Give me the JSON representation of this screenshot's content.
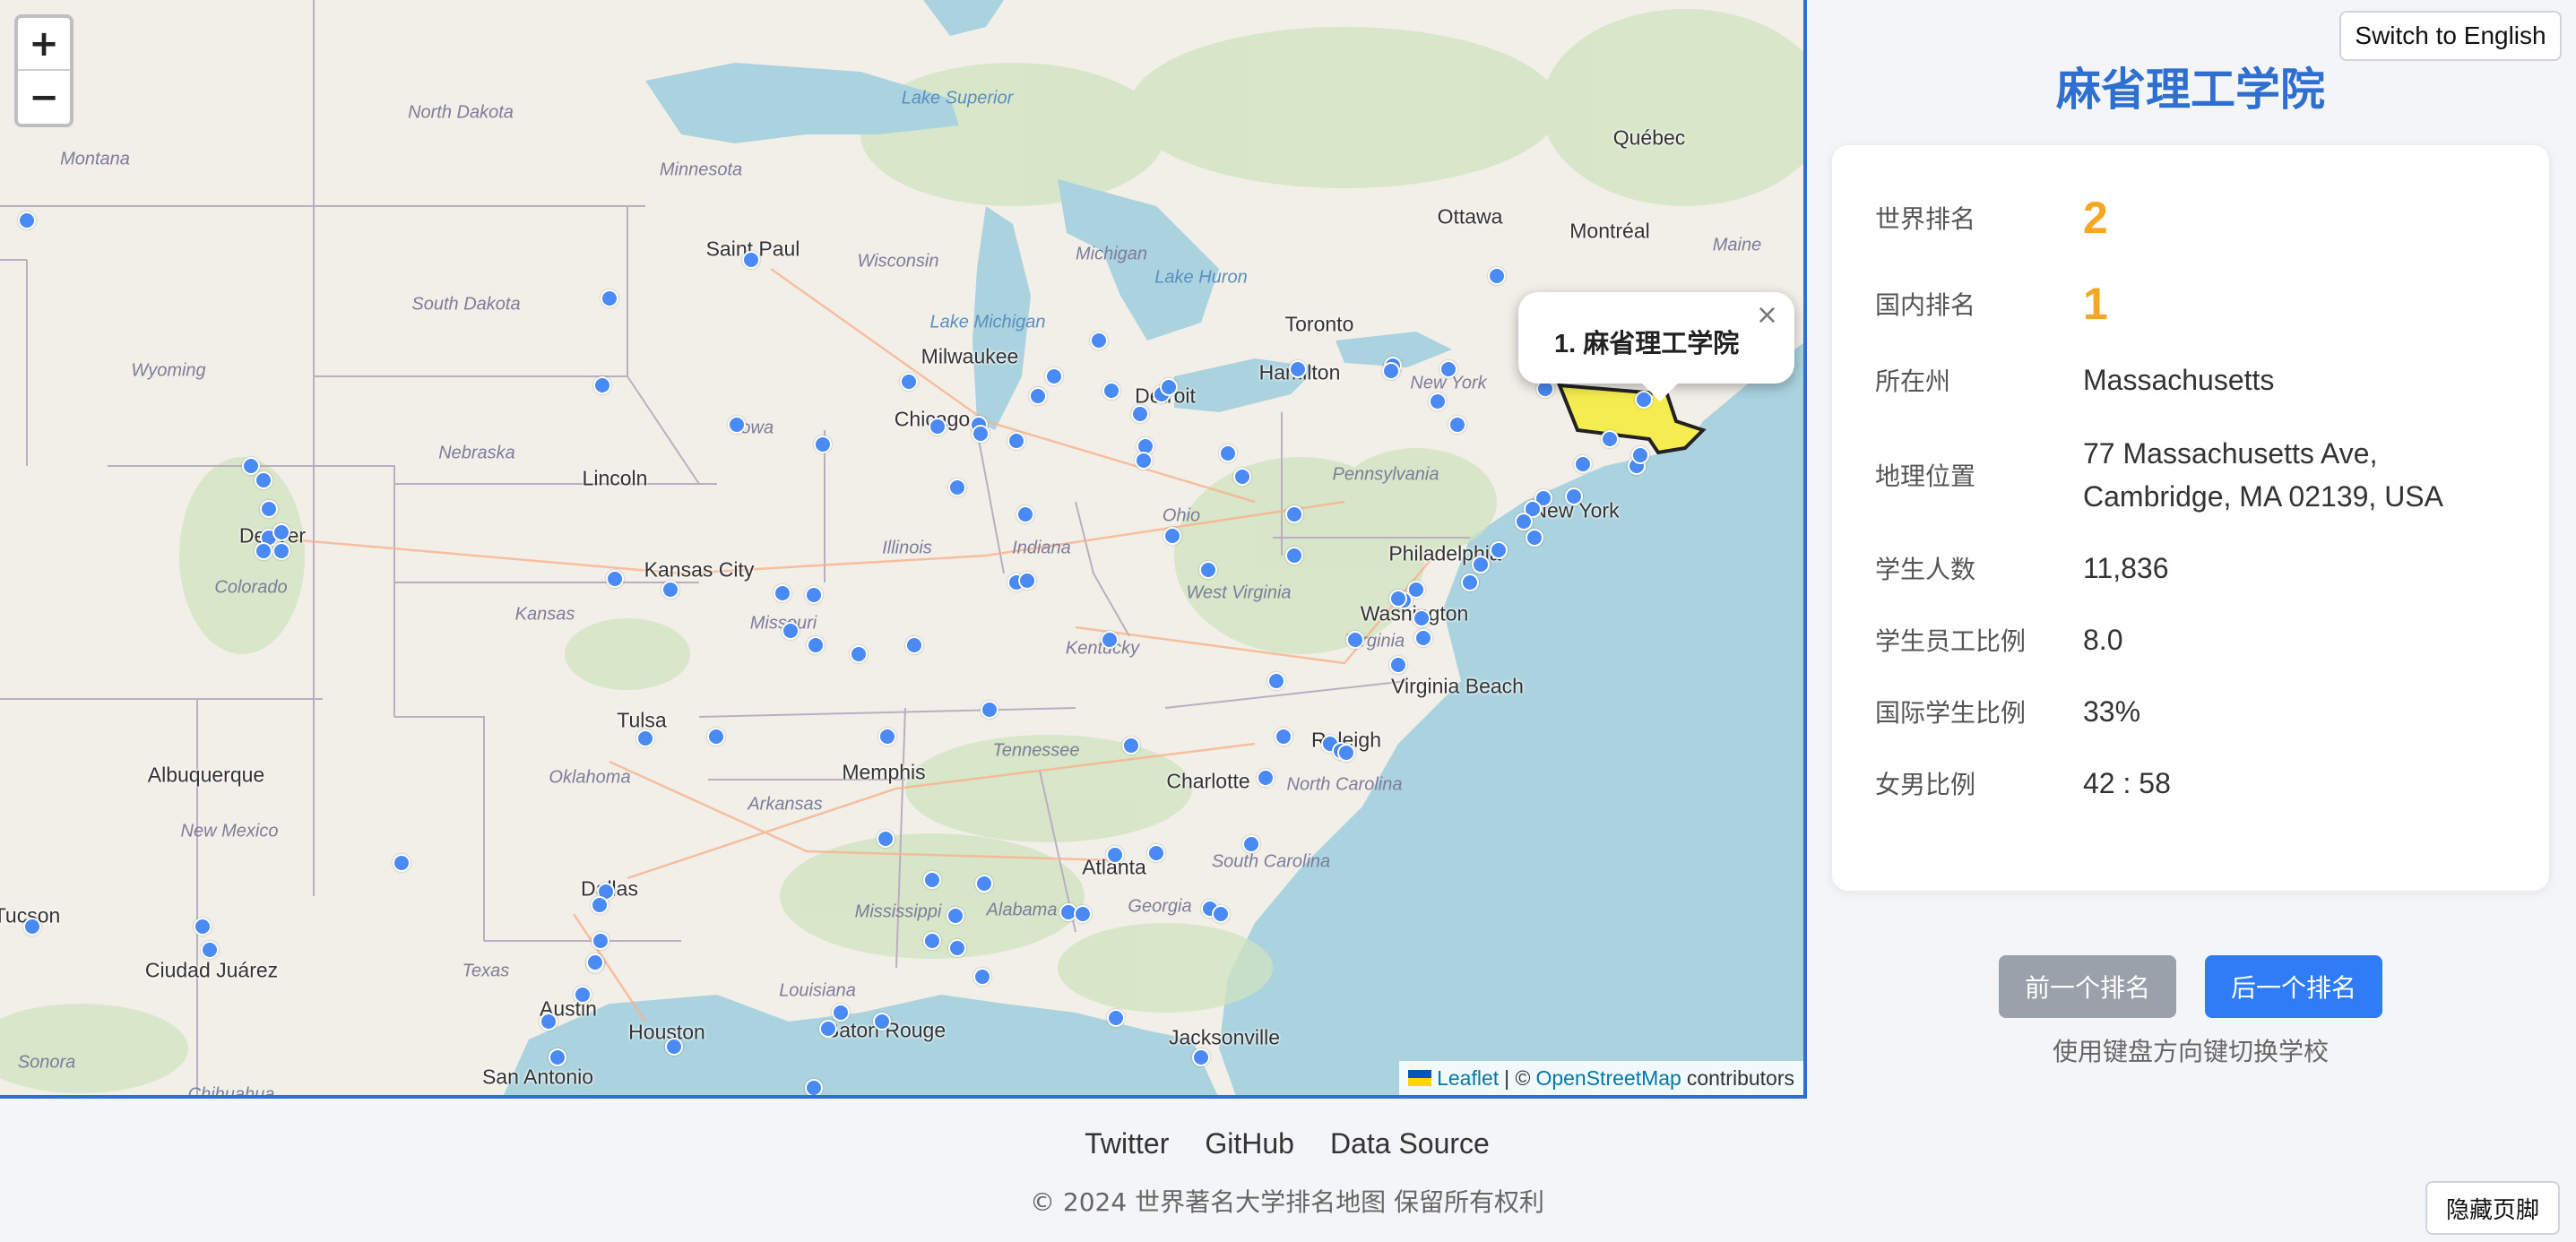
{
  "map": {
    "zoom_in_label": "+",
    "zoom_out_label": "−",
    "popup": {
      "text": "1. 麻省理工学院",
      "close_label": "×"
    },
    "attribution": {
      "leaflet": "Leaflet",
      "separator": "| ©",
      "osm": "OpenStreetMap",
      "suffix": "contributors"
    },
    "labels": {
      "cities": [
        "Saint Paul",
        "Milwaukee",
        "Chicago",
        "Detroit",
        "Toronto",
        "Hamilton",
        "Ottawa",
        "Montréal",
        "Québec",
        "New York",
        "Philadelphia",
        "Washington",
        "Virginia Beach",
        "Raleigh",
        "Charlotte",
        "Atlanta",
        "Jacksonville",
        "Memphis",
        "Tulsa",
        "Kansas City",
        "Lincoln",
        "Denver",
        "Albuquerque",
        "Dallas",
        "Austin",
        "Houston",
        "San Antonio",
        "Baton Rouge",
        "Ciudad Juárez",
        "Tucson"
      ],
      "regions": [
        "North Dakota",
        "South Dakota",
        "Montana",
        "Wyoming",
        "Nebraska",
        "Colorado",
        "Kansas",
        "Oklahoma",
        "Iowa",
        "Minnesota",
        "Wisconsin",
        "Michigan",
        "Illinois",
        "Indiana",
        "Ohio",
        "Missouri",
        "Kentucky",
        "Tennessee",
        "Arkansas",
        "Mississippi",
        "Alabama",
        "Georgia",
        "Louisiana",
        "Texas",
        "New Mexico",
        "West Virginia",
        "Virginia",
        "North Carolina",
        "South Carolina",
        "Pennsylvania",
        "New York",
        "Maine",
        "Sonora",
        "Chihuahua"
      ],
      "water": [
        "Lake Superior",
        "Lake Michigan",
        "Lake Huron"
      ]
    },
    "marker_color": "#4a8af4",
    "highlight_state": "Massachusetts",
    "highlight_color": "#f5ec4f"
  },
  "panel": {
    "lang_button": "Switch to English",
    "title": "麻省理工学院",
    "rows": [
      {
        "key": "世界排名",
        "value": "2"
      },
      {
        "key": "国内排名",
        "value": "1"
      },
      {
        "key": "所在州",
        "value": "Massachusetts"
      },
      {
        "key": "地理位置",
        "value": "77 Massachusetts Ave,",
        "value2": "Cambridge, MA 02139, USA"
      },
      {
        "key": "学生人数",
        "value": "11,836"
      },
      {
        "key": "学生员工比例",
        "value": "8.0"
      },
      {
        "key": "国际学生比例",
        "value": "33%"
      },
      {
        "key": "女男比例",
        "value": "42 : 58"
      }
    ],
    "prev_button": "前一个排名",
    "next_button": "后一个排名",
    "hint": "使用键盘方向键切换学校",
    "accent_color": "#2f6fd0",
    "rank_color": "#f5a623"
  },
  "footer": {
    "links": [
      "Twitter",
      "GitHub",
      "Data Source"
    ],
    "copyright": "© 2024 世界著名大学排名地图 保留所有权利",
    "hide_button": "隐藏页脚"
  }
}
